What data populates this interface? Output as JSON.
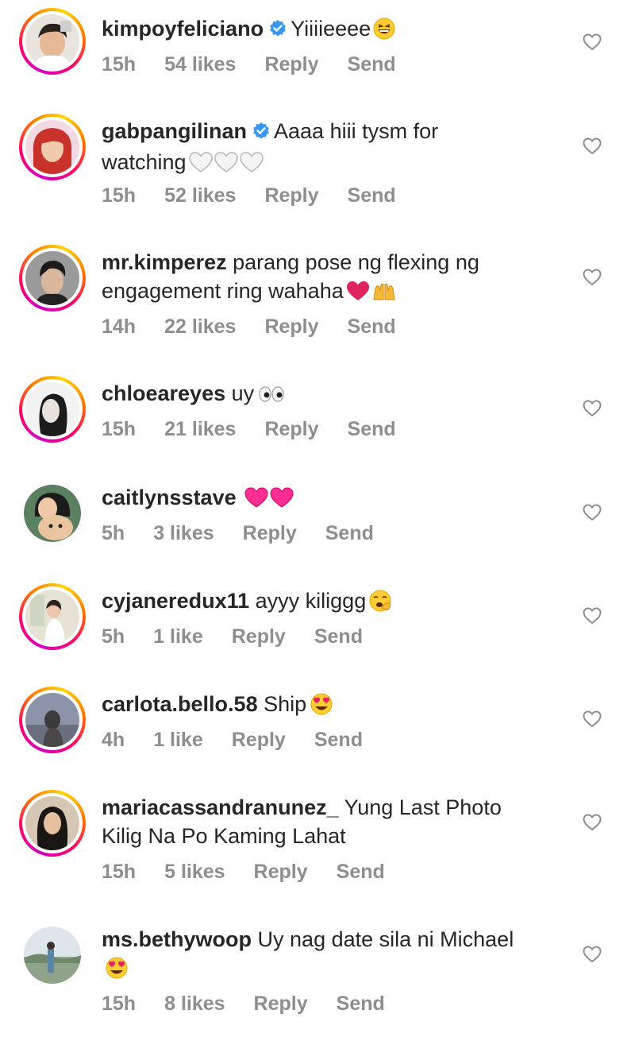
{
  "comments": [
    {
      "username": "kimpoyfeliciano",
      "verified": true,
      "line1": "Yiiiieeee",
      "line2": "",
      "emoji": "laughing-face",
      "time": "15h",
      "likes": "54 likes",
      "reply": "Reply",
      "send": "Send"
    },
    {
      "username": "gabpangilinan",
      "verified": true,
      "line1": "Aaaa hiii tysm for",
      "line2": "watching",
      "emoji": "white-hearts",
      "time": "15h",
      "likes": "52 likes",
      "reply": "Reply",
      "send": "Send"
    },
    {
      "username": "mr.kimperez",
      "verified": false,
      "line1": "parang pose ng flexing ng",
      "line2": "engagement ring wahaha",
      "emoji": "red-heart-raising-hands",
      "time": "14h",
      "likes": "22 likes",
      "reply": "Reply",
      "send": "Send"
    },
    {
      "username": "chloeareyes",
      "verified": false,
      "line1": "uy",
      "line2": "",
      "emoji": "eyes",
      "time": "15h",
      "likes": "21 likes",
      "reply": "Reply",
      "send": "Send"
    },
    {
      "username": "caitlynsstave",
      "verified": false,
      "line1": "",
      "line2": "",
      "emoji": "pink-hearts",
      "time": "5h",
      "likes": "3 likes",
      "reply": "Reply",
      "send": "Send"
    },
    {
      "username": "cyjaneredux11",
      "verified": false,
      "line1": "ayyy kiliggg",
      "line2": "",
      "emoji": "yawning-face",
      "time": "5h",
      "likes": "1 like",
      "reply": "Reply",
      "send": "Send"
    },
    {
      "username": "carlota.bello.58",
      "verified": false,
      "line1": "Ship",
      "line2": "",
      "emoji": "heart-eyes",
      "time": "4h",
      "likes": "1 like",
      "reply": "Reply",
      "send": "Send"
    },
    {
      "username": "mariacassandranunez_",
      "verified": false,
      "line1": "Yung Last Photo",
      "line2": "Kilig Na Po Kaming Lahat",
      "emoji": "",
      "time": "15h",
      "likes": "5 likes",
      "reply": "Reply",
      "send": "Send"
    },
    {
      "username": "ms.bethywoop",
      "verified": false,
      "line1": "Uy nag date sila ni Michael",
      "line2": "",
      "emoji": "heart-eyes",
      "time": "15h",
      "likes": "8 likes",
      "reply": "Reply",
      "send": "Send"
    }
  ],
  "colors": {
    "text": "#262626",
    "meta": "#8e8e8e",
    "verified": "#3897f0",
    "heart_icon": "#8e8e8e"
  }
}
